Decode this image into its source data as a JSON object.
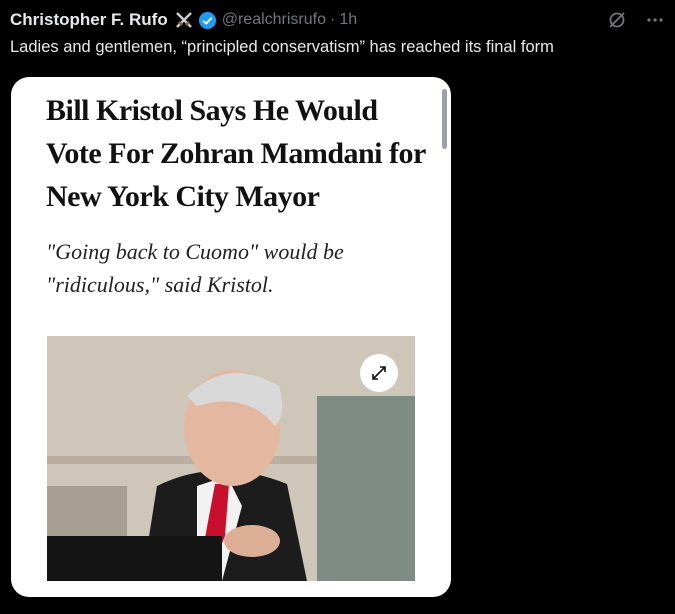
{
  "tweet": {
    "author_name": "Christopher F. Rufo",
    "handle": "@realchrisrufo",
    "separator": "·",
    "time": "1h",
    "text": "Ladies and gentlemen, “principled conservatism” has reached its final form"
  },
  "card": {
    "headline": "Bill Kristol Says He Would Vote For Zohran Mamdani for New York City Mayor",
    "subhead": "\"Going back to Cuomo\" would be \"ridiculous,\" said Kristol."
  },
  "icons": {
    "badge": "crossed-swords-icon",
    "verified": "verified-badge-icon",
    "grok": "grok-icon",
    "more": "more-icon",
    "expand": "expand-icon"
  },
  "colors": {
    "background": "#000000",
    "verified": "#1d9bf0",
    "muted": "#71767b",
    "tie": "#c8102e"
  }
}
